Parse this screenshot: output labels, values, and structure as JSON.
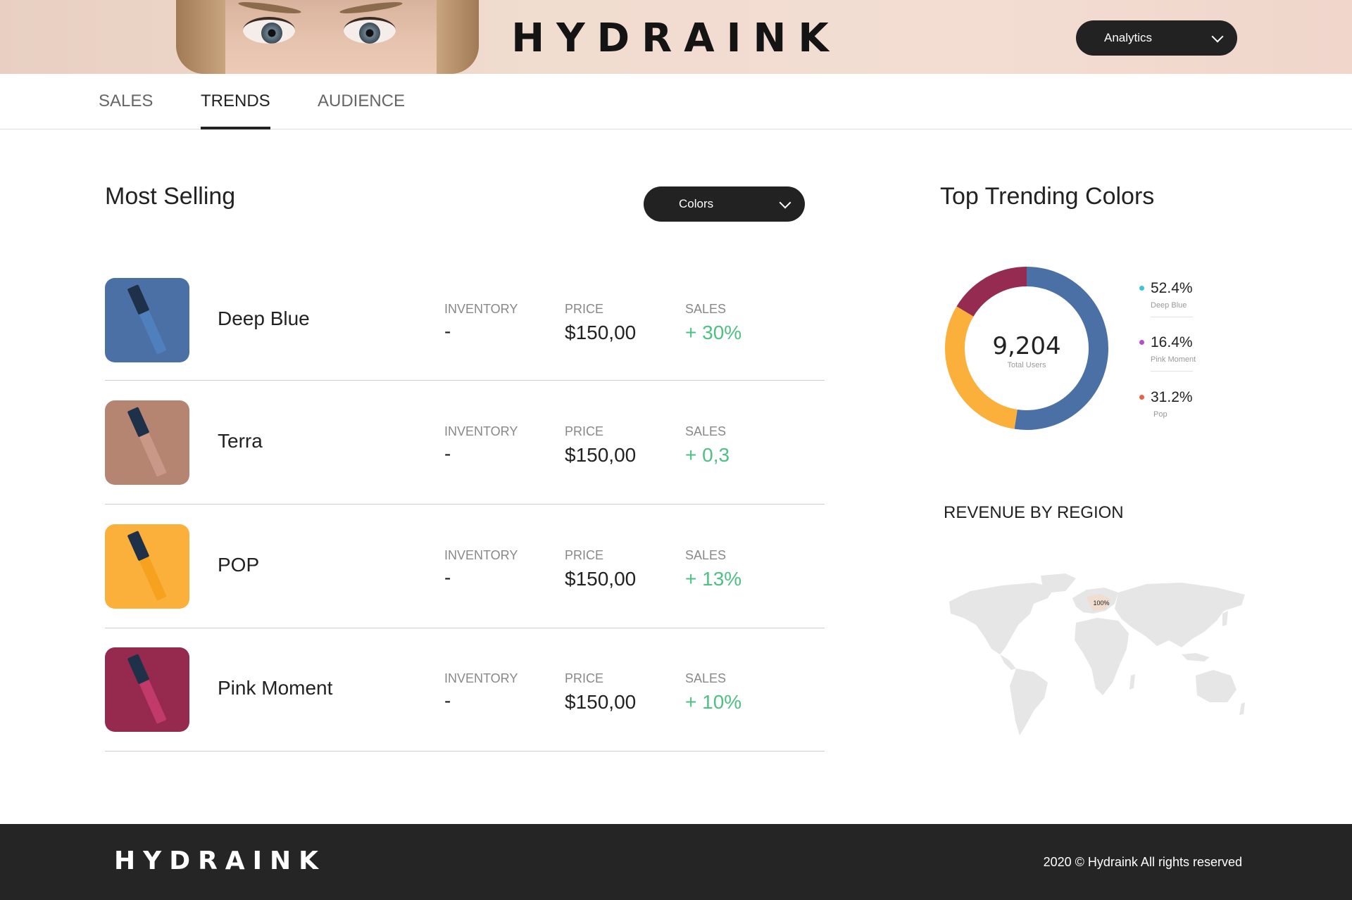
{
  "header": {
    "brand": "HYDRAINK",
    "menu_button": "Analytics"
  },
  "tabs": [
    {
      "label": "SALES",
      "active": false
    },
    {
      "label": "TRENDS",
      "active": true
    },
    {
      "label": "AUDIENCE",
      "active": false
    }
  ],
  "most_selling": {
    "title": "Most Selling",
    "filter_button": "Colors",
    "column_labels": {
      "inventory": "INVENTORY",
      "price": "PRICE",
      "sales": "SALES"
    },
    "products": [
      {
        "name": "Deep Blue",
        "swatch": "#4a70a6",
        "body_color": "#4f7fbc",
        "inventory": "-",
        "price": "$150,00",
        "sales": "+ 30%"
      },
      {
        "name": "Terra",
        "swatch": "#b68572",
        "body_color": "#c99886",
        "inventory": "-",
        "price": "$150,00",
        "sales": "+ 0,3"
      },
      {
        "name": "POP",
        "swatch": "#fbb03b",
        "body_color": "#f6a21e",
        "inventory": "-",
        "price": "$150,00",
        "sales": "+ 13%"
      },
      {
        "name": "Pink Moment",
        "swatch": "#962a4e",
        "body_color": "#c13a69",
        "inventory": "-",
        "price": "$150,00",
        "sales": "+ 10%"
      }
    ]
  },
  "trending": {
    "title": "Top Trending Colors",
    "total_value": "9,204",
    "total_label": "Total Users",
    "legend": [
      {
        "pct": "52.4%",
        "name": "Deep Blue",
        "dot": "#3cc6d1"
      },
      {
        "pct": "16.4%",
        "name": "Pink Moment",
        "dot": "#b54fd0"
      },
      {
        "pct": "31.2%",
        "name": "Pop",
        "dot": "#e8624b"
      }
    ]
  },
  "chart_data": {
    "type": "pie",
    "categories": [
      "Deep Blue",
      "Pink Moment",
      "Pop"
    ],
    "values": [
      52.4,
      16.4,
      31.2
    ],
    "colors": [
      "#4a70a6",
      "#952b51",
      "#fbb03b"
    ],
    "title": "Top Trending Colors"
  },
  "region": {
    "title": "REVENUE BY REGION",
    "highlight_label": "100%"
  },
  "footer": {
    "brand": "HYDRAINK",
    "copyright": "2020 © Hydraink All rights reserved"
  },
  "colors": {
    "accent_dark": "#222222",
    "sales_green": "#4fc083",
    "header_bg": "#f1dcd0",
    "footer_bg": "#252525"
  }
}
